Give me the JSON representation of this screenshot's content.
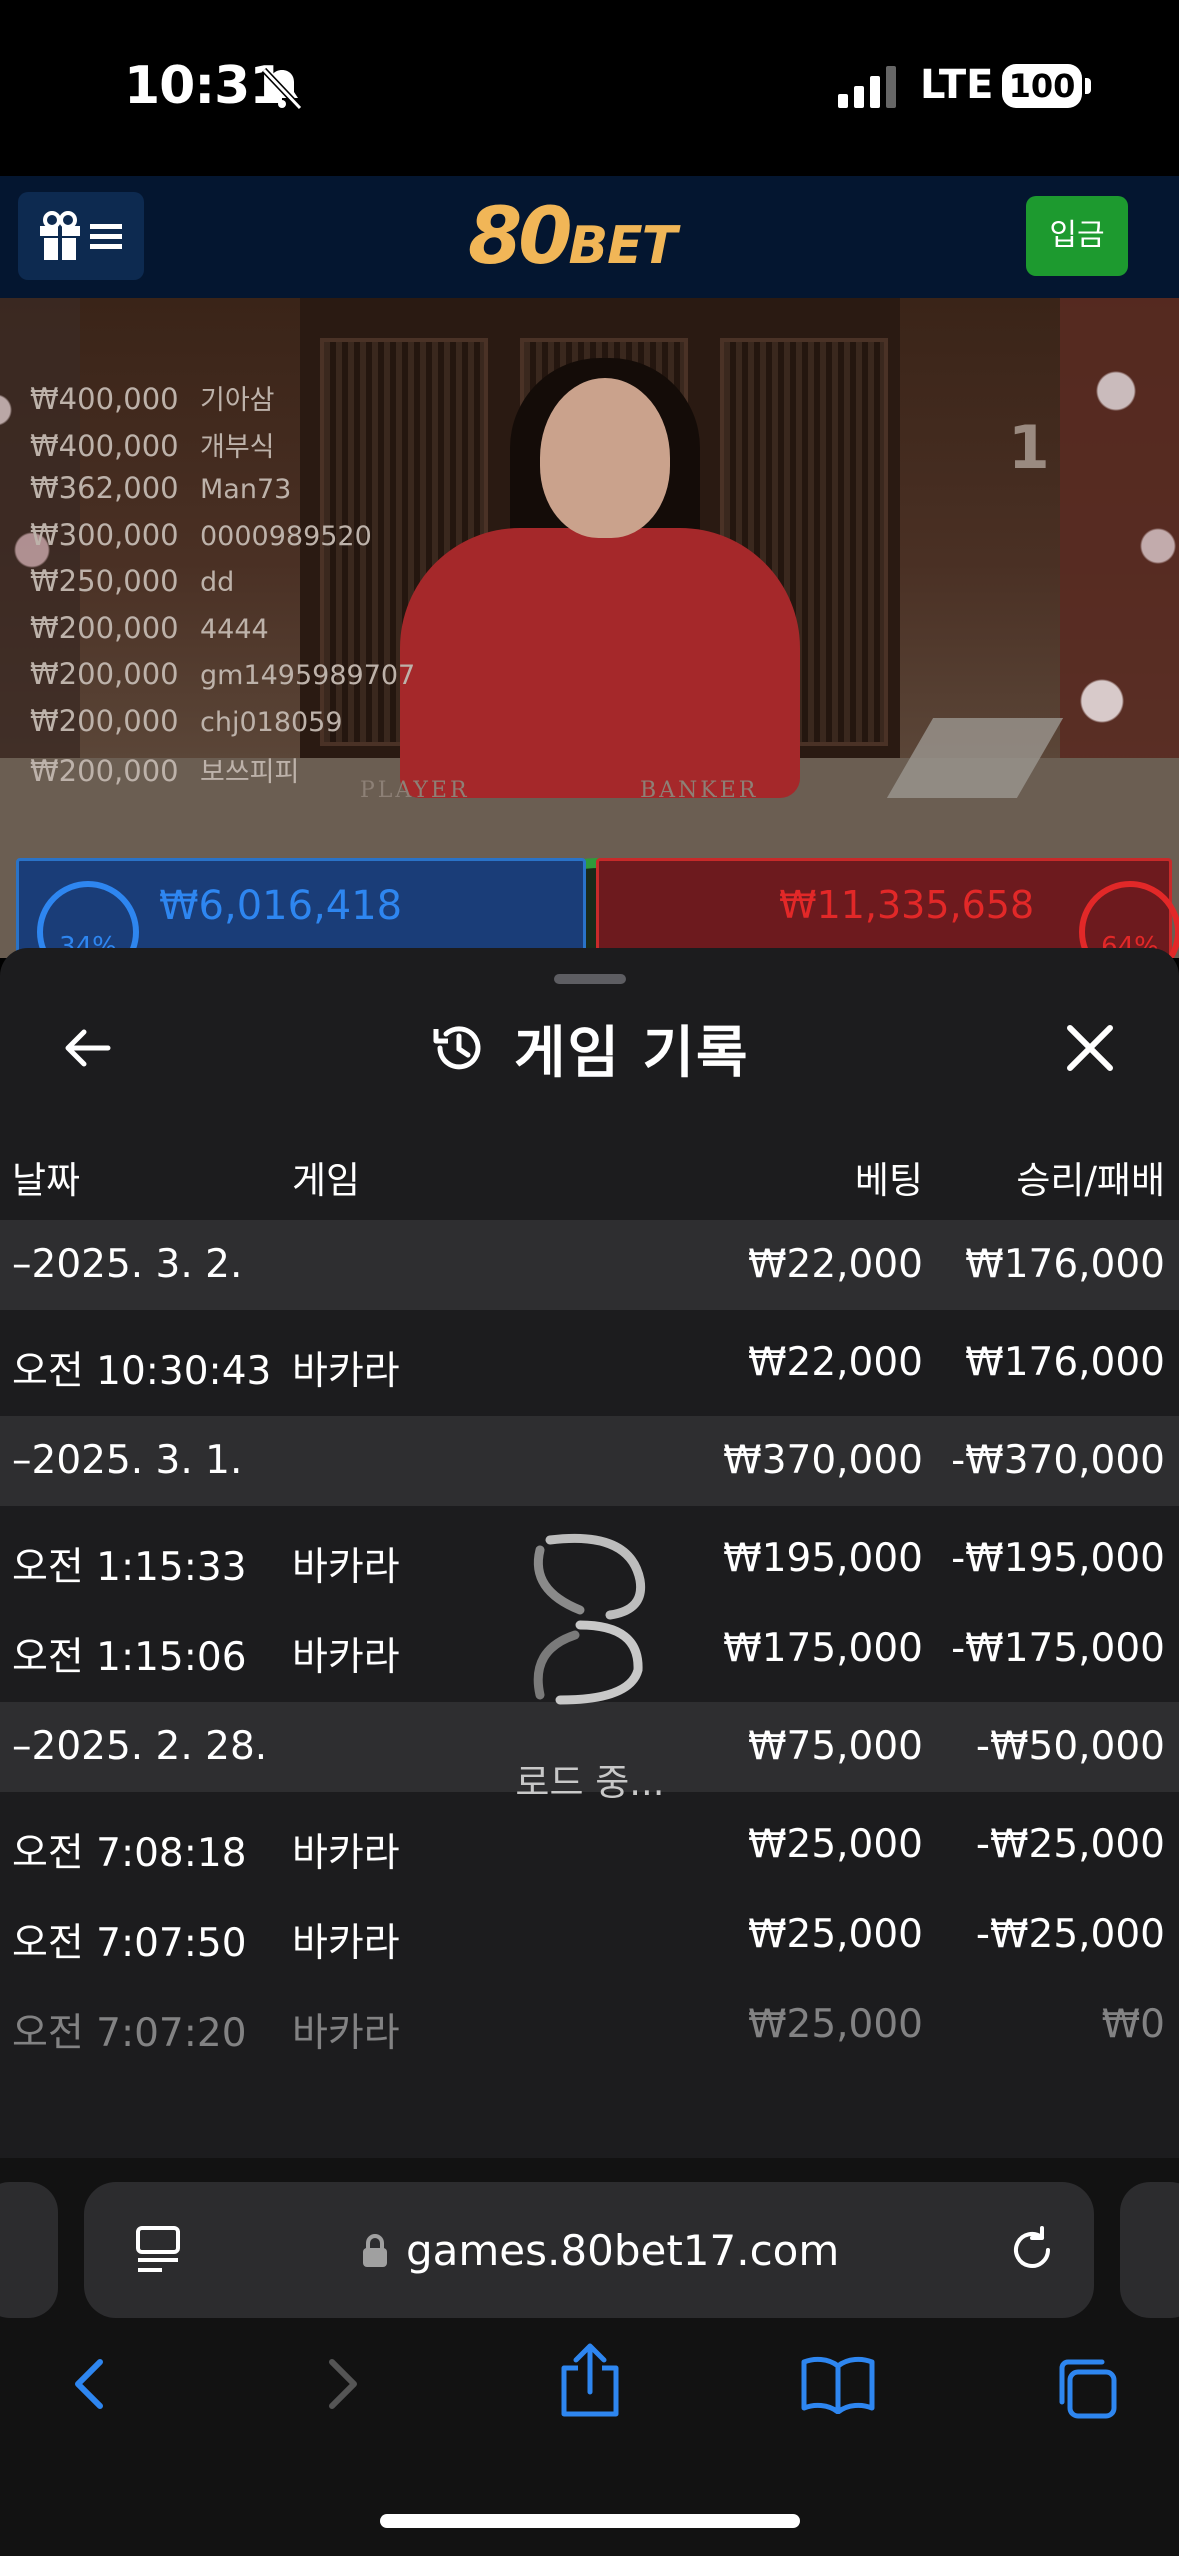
{
  "status_bar": {
    "time": "10:31",
    "network": "LTE",
    "battery": "100"
  },
  "site": {
    "logo_num": "80",
    "logo_word": "BET",
    "deposit_label": "입금"
  },
  "video": {
    "round_number": "1",
    "table_labels": {
      "player": "PLAYER",
      "banker": "BANKER"
    },
    "winners": [
      {
        "amount": "₩400,000",
        "name": "기아삼"
      },
      {
        "amount": "₩400,000",
        "name": "개부식"
      },
      {
        "amount": "₩362,000",
        "name": "Man73"
      },
      {
        "amount": "₩300,000",
        "name": "0000989520"
      },
      {
        "amount": "₩250,000",
        "name": "dd"
      },
      {
        "amount": "₩200,000",
        "name": "4444"
      },
      {
        "amount": "₩200,000",
        "name": "gm1495989707"
      },
      {
        "amount": "₩200,000",
        "name": "chj018059"
      },
      {
        "amount": "₩200,000",
        "name": "보쓰피피"
      }
    ],
    "player_total": "₩6,016,418",
    "player_pct": "34%",
    "banker_total": "₩11,335,658",
    "banker_pct": "64%"
  },
  "sheet": {
    "title": "게임 기록",
    "columns": {
      "date": "날짜",
      "game": "게임",
      "bet": "베팅",
      "result": "승리/패배"
    },
    "rows": [
      {
        "type": "group",
        "date": "–2025. 3. 2.",
        "game": "",
        "bet": "₩22,000",
        "result": "₩176,000"
      },
      {
        "type": "item",
        "date": "오전 10:30:43",
        "game": "바카라",
        "bet": "₩22,000",
        "result": "₩176,000"
      },
      {
        "type": "group",
        "date": "–2025. 3. 1.",
        "game": "",
        "bet": "₩370,000",
        "result": "-₩370,000"
      },
      {
        "type": "item",
        "date": "오전 1:15:33",
        "game": "바카라",
        "bet": "₩195,000",
        "result": "-₩195,000"
      },
      {
        "type": "item",
        "date": "오전 1:15:06",
        "game": "바카라",
        "bet": "₩175,000",
        "result": "-₩175,000"
      },
      {
        "type": "group",
        "date": "–2025. 2. 28.",
        "game": "",
        "bet": "₩75,000",
        "result": "-₩50,000"
      },
      {
        "type": "item",
        "date": "오전 7:08:18",
        "game": "바카라",
        "bet": "₩25,000",
        "result": "-₩25,000"
      },
      {
        "type": "item",
        "date": "오전 7:07:50",
        "game": "바카라",
        "bet": "₩25,000",
        "result": "-₩25,000"
      },
      {
        "type": "item",
        "date": "오전 7:07:20",
        "game": "바카라",
        "bet": "₩25,000",
        "result": "₩0"
      }
    ],
    "loading_text": "로드 중..."
  },
  "browser": {
    "url": "games.80bet17.com"
  },
  "colors": {
    "accent_blue": "#2e86f0",
    "logo_gold": "#f1b657",
    "deposit_green": "#1d9a2f",
    "banker_red": "#e22828"
  }
}
